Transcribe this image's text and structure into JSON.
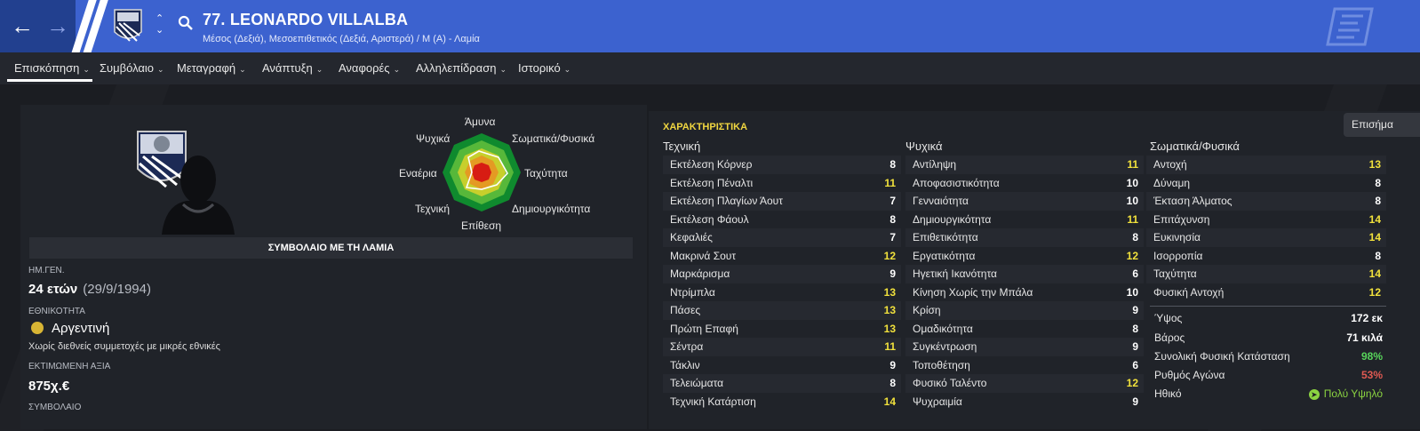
{
  "header": {
    "player_name": "77. LEONARDO VILLALBA",
    "subtitle": "Μέσος (Δεξιά), Μεσοεπιθετικός (Δεξιά, Αριστερά) / Μ (Α) - Λαμία",
    "color": "#3c62cf"
  },
  "tabs": [
    {
      "label": "Επισκόπηση"
    },
    {
      "label": "Συμβόλαιο"
    },
    {
      "label": "Μεταγραφή"
    },
    {
      "label": "Ανάπτυξη"
    },
    {
      "label": "Αναφορές"
    },
    {
      "label": "Αλληλεπίδραση"
    },
    {
      "label": "Ιστορικό"
    }
  ],
  "radar": {
    "top": "Άμυνα",
    "top_left": "Ψυχικά",
    "top_right": "Σωματικά/Φυσικά",
    "left": "Εναέρια",
    "right": "Ταχύτητα",
    "bottom_left": "Τεχνική",
    "bottom_right": "Δημιουργικότητα",
    "bottom": "Επίθεση"
  },
  "profile": {
    "contract_banner": "ΣΥΜΒΟΛΑΙΟ ΜΕ ΤΗ ΛΑΜΙΑ",
    "dob_label": "ΗΜ.ΓΕΝ.",
    "age": "24 ετών",
    "dob": "(29/9/1994)",
    "nationality_label": "ΕΘΝΙΚΟΤΗΤΑ",
    "nationality": "Αργεντινή",
    "intl_note": "Χωρίς διεθνείς συμμετοχές με μικρές εθνικές",
    "value_label": "ΕΚΤΙΜΩΜΕΝΗ ΑΞΙΑ",
    "value": "875χ.€",
    "contract_label": "ΣΥΜΒΟΛΑΙΟ"
  },
  "attributes": {
    "title": "ΧΑΡΑΚΤΗΡΙΣΤΙΚΑ",
    "button": "Επισήμα",
    "technical": {
      "heading": "Τεχνική",
      "items": [
        {
          "name": "Εκτέλεση Κόρνερ",
          "value": "8"
        },
        {
          "name": "Εκτέλεση Πέναλτι",
          "value": "11"
        },
        {
          "name": "Εκτέλεση Πλαγίων Άουτ",
          "value": "7"
        },
        {
          "name": "Εκτέλεση Φάουλ",
          "value": "8"
        },
        {
          "name": "Κεφαλιές",
          "value": "7"
        },
        {
          "name": "Μακρινά Σουτ",
          "value": "12"
        },
        {
          "name": "Μαρκάρισμα",
          "value": "9"
        },
        {
          "name": "Ντρίμπλα",
          "value": "13"
        },
        {
          "name": "Πάσες",
          "value": "13"
        },
        {
          "name": "Πρώτη Επαφή",
          "value": "13"
        },
        {
          "name": "Σέντρα",
          "value": "11"
        },
        {
          "name": "Τάκλιν",
          "value": "9"
        },
        {
          "name": "Τελειώματα",
          "value": "8"
        },
        {
          "name": "Τεχνική Κατάρτιση",
          "value": "14"
        }
      ]
    },
    "mental": {
      "heading": "Ψυχικά",
      "items": [
        {
          "name": "Αντίληψη",
          "value": "11"
        },
        {
          "name": "Αποφασιστικότητα",
          "value": "10"
        },
        {
          "name": "Γενναιότητα",
          "value": "10"
        },
        {
          "name": "Δημιουργικότητα",
          "value": "11"
        },
        {
          "name": "Επιθετικότητα",
          "value": "8"
        },
        {
          "name": "Εργατικότητα",
          "value": "12"
        },
        {
          "name": "Ηγετική Ικανότητα",
          "value": "6"
        },
        {
          "name": "Κίνηση Χωρίς την Μπάλα",
          "value": "10"
        },
        {
          "name": "Κρίση",
          "value": "9"
        },
        {
          "name": "Ομαδικότητα",
          "value": "8"
        },
        {
          "name": "Συγκέντρωση",
          "value": "9"
        },
        {
          "name": "Τοποθέτηση",
          "value": "6"
        },
        {
          "name": "Φυσικό Ταλέντο",
          "value": "12"
        },
        {
          "name": "Ψυχραιμία",
          "value": "9"
        }
      ]
    },
    "physical": {
      "heading": "Σωματικά/Φυσικά",
      "items": [
        {
          "name": "Αντοχή",
          "value": "13"
        },
        {
          "name": "Δύναμη",
          "value": "8"
        },
        {
          "name": "Έκταση Άλματος",
          "value": "8"
        },
        {
          "name": "Επιτάχυνση",
          "value": "14"
        },
        {
          "name": "Ευκινησία",
          "value": "14"
        },
        {
          "name": "Ισορροπία",
          "value": "8"
        },
        {
          "name": "Ταχύτητα",
          "value": "14"
        },
        {
          "name": "Φυσική Αντοχή",
          "value": "12"
        }
      ]
    },
    "info": {
      "height_label": "Ύψος",
      "height": "172 εκ",
      "weight_label": "Βάρος",
      "weight": "71 κιλά",
      "condition_label": "Συνολική Φυσική Κατάσταση",
      "condition": "98%",
      "match_fitness_label": "Ρυθμός Αγώνα",
      "match_fitness": "53%",
      "morale_label": "Ηθικό",
      "morale": "Πολύ Υψηλό"
    }
  }
}
